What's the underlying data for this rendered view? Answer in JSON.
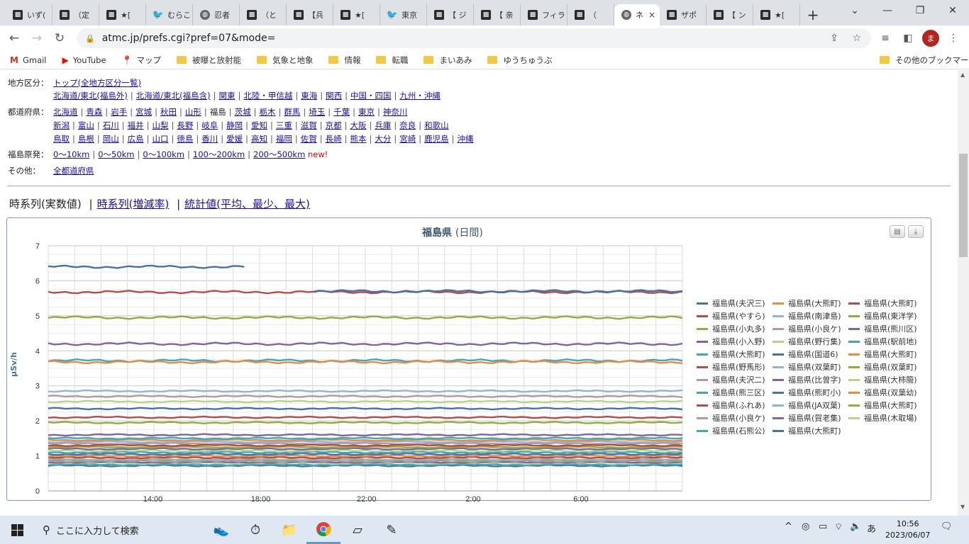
{
  "tabs": [
    {
      "title": "いず(",
      "icon": "site-favicon"
    },
    {
      "title": "（定",
      "icon": "site-favicon"
    },
    {
      "title": "★[",
      "icon": "site-favicon"
    },
    {
      "title": "むらこ",
      "icon": "twitter-icon"
    },
    {
      "title": "忍者",
      "icon": "globe-icon"
    },
    {
      "title": "（と",
      "icon": "site-favicon"
    },
    {
      "title": "【兵",
      "icon": "site-favicon"
    },
    {
      "title": "★[",
      "icon": "site-favicon"
    },
    {
      "title": "東京",
      "icon": "twitter-icon"
    },
    {
      "title": "【 ジ",
      "icon": "site-favicon"
    },
    {
      "title": "【 亲",
      "icon": "site-favicon"
    },
    {
      "title": "フィラ",
      "icon": "fi-icon"
    },
    {
      "title": "（",
      "icon": "site-favicon"
    },
    {
      "title": "ネ",
      "icon": "globe-icon",
      "active": true
    },
    {
      "title": "ザポ",
      "icon": "fi-icon"
    },
    {
      "title": "【 ン",
      "icon": "site-favicon"
    },
    {
      "title": "★[",
      "icon": "site-favicon"
    }
  ],
  "browser": {
    "url": "atmc.jp/prefs.cgi?pref=07&mode=",
    "avatar": "ま",
    "new_tab": "+",
    "close": "×"
  },
  "bookmarks": [
    {
      "label": "Gmail",
      "icon": "gmail-icon"
    },
    {
      "label": "YouTube",
      "icon": "youtube-icon"
    },
    {
      "label": "マップ",
      "icon": "maps-icon"
    },
    {
      "label": "被曝と放射能",
      "icon": "folder-icon"
    },
    {
      "label": "気象と地象",
      "icon": "folder-icon"
    },
    {
      "label": "情報",
      "icon": "folder-icon"
    },
    {
      "label": "転職",
      "icon": "folder-icon"
    },
    {
      "label": "まいあみ",
      "icon": "folder-icon"
    },
    {
      "label": "ゆうちゅうぶ",
      "icon": "folder-icon"
    }
  ],
  "other_bookmarks": "その他のブックマーク",
  "nav": {
    "region_label": "地方区分：",
    "region_top": "トップ(全地方区分一覧)",
    "regions": [
      "北海道/東北(福島外)",
      "北海道/東北(福島含)",
      "関東",
      "北陸・甲信越",
      "東海",
      "関西",
      "中国・四国",
      "九州・沖縄"
    ],
    "pref_label": "都道府県：",
    "prefs_row1": [
      "北海道",
      "青森",
      "岩手",
      "宮城",
      "秋田",
      "山形",
      "福島",
      "茨城",
      "栃木",
      "群馬",
      "埼玉",
      "千葉",
      "東京",
      "神奈川"
    ],
    "prefs_row2": [
      "新潟",
      "富山",
      "石川",
      "福井",
      "山梨",
      "長野",
      "岐阜",
      "静岡",
      "愛知",
      "三重",
      "滋賀",
      "京都",
      "大阪",
      "兵庫",
      "奈良",
      "和歌山"
    ],
    "prefs_row3": [
      "鳥取",
      "島根",
      "岡山",
      "広島",
      "山口",
      "徳島",
      "香川",
      "愛媛",
      "高知",
      "福岡",
      "佐賀",
      "長崎",
      "熊本",
      "大分",
      "宮崎",
      "鹿児島",
      "沖縄"
    ],
    "current_pref": "福島",
    "plant_label": "福島原発：",
    "plant_links": [
      "0〜10km",
      "0〜50km",
      "0〜100km",
      "100〜200km",
      "200〜500km"
    ],
    "new_tag": "new!",
    "other_label": "その他：",
    "other_link": "全都道府県"
  },
  "view_selector": {
    "current": "時系列(実数値)",
    "links": [
      "時系列(増減率)",
      "統計値(平均、最少、最大)"
    ],
    "sep": "|"
  },
  "chart_data": {
    "type": "line",
    "title": "福島県",
    "subtitle": "(日間)",
    "ylabel": "μSv/h",
    "ylim": [
      0,
      7
    ],
    "yticks": [
      0,
      1,
      2,
      3,
      4,
      5,
      6,
      7
    ],
    "xticks": [
      "14:00",
      "18:00",
      "22:00",
      "2:00",
      "6:00"
    ],
    "grid": true,
    "legend_position": "right",
    "series": [
      {
        "name": "福島県(夫沢三)",
        "color": "#4572a7",
        "level": 6.4,
        "start": 0,
        "end": 0.31,
        "gap2": [
          0.42,
          1.0
        ],
        "level2": 5.7
      },
      {
        "name": "福島県(大熊町)",
        "color": "#ee8a3c",
        "level": 3.68
      },
      {
        "name": "福島県(大熊町)",
        "color": "#b94a48",
        "level": 5.68
      },
      {
        "name": "福島県(やすら)",
        "color": "#b94a48",
        "level": 2.1
      },
      {
        "name": "福島県(南津島)",
        "color": "#8fb3dd",
        "level": 2.85
      },
      {
        "name": "福島県(東洋学)",
        "color": "#8daf3f",
        "level": 4.95
      },
      {
        "name": "福島県(小丸多)",
        "color": "#8daf3f",
        "level": 1.95
      },
      {
        "name": "福島県(小良ケ)",
        "color": "#b09a9a",
        "level": 2.7
      },
      {
        "name": "福島県(熊川区)",
        "color": "#7e65a3",
        "level": 4.2
      },
      {
        "name": "福島県(小入野)",
        "color": "#7e65a3",
        "level": 1.6
      },
      {
        "name": "福島県(野行集)",
        "color": "#b8d38a",
        "level": 2.55
      },
      {
        "name": "福島県(駅前地)",
        "color": "#3ea9bd",
        "level": 3.72
      },
      {
        "name": "福島県(大熊町)",
        "color": "#3ea9bd",
        "level": 1.5
      },
      {
        "name": "福島県(国道6)",
        "color": "#4572a7",
        "level": 2.35
      },
      {
        "name": "福島県(大熊町)",
        "color": "#ee8a3c",
        "level": 1.45
      },
      {
        "name": "福島県(野馬形)",
        "color": "#b94a48",
        "level": 1.3
      },
      {
        "name": "福島県(双葉町)",
        "color": "#8fb3dd",
        "level": 1.4
      },
      {
        "name": "福島県(双葉町)",
        "color": "#8daf3f",
        "level": 1.25
      },
      {
        "name": "福島県(夫沢二)",
        "color": "#b09a9a",
        "level": 1.35
      },
      {
        "name": "福島県(比曽字)",
        "color": "#7e65a3",
        "level": 1.2
      },
      {
        "name": "福島県(大柿簡)",
        "color": "#b8d38a",
        "level": 1.15
      },
      {
        "name": "福島県(熊三区)",
        "color": "#3ea9bd",
        "level": 1.1
      },
      {
        "name": "福島県(熊町小)",
        "color": "#4572a7",
        "level": 1.05
      },
      {
        "name": "福島県(双葉幼)",
        "color": "#ee8a3c",
        "level": 1.0
      },
      {
        "name": "福島県(ふれあ)",
        "color": "#b94a48",
        "level": 0.95
      },
      {
        "name": "福島県(JA双葉)",
        "color": "#8fb3dd",
        "level": 0.9
      },
      {
        "name": "福島県(大熊町)",
        "color": "#8daf3f",
        "level": 0.88
      },
      {
        "name": "福島県(小良ケ)",
        "color": "#b09a9a",
        "level": 0.85
      },
      {
        "name": "福島県(賀老集)",
        "color": "#7e65a3",
        "level": 0.82
      },
      {
        "name": "福島県(木取場)",
        "color": "#b8d38a",
        "level": 0.8
      },
      {
        "name": "福島県(石熊公)",
        "color": "#3ea9bd",
        "level": 0.75
      },
      {
        "name": "福島県(大熊町)",
        "color": "#4572a7",
        "level": 0.72
      }
    ]
  },
  "taskbar": {
    "search_placeholder": "ここに入力して検索",
    "time": "10:56",
    "date": "2023/06/07",
    "ime": "あ"
  }
}
